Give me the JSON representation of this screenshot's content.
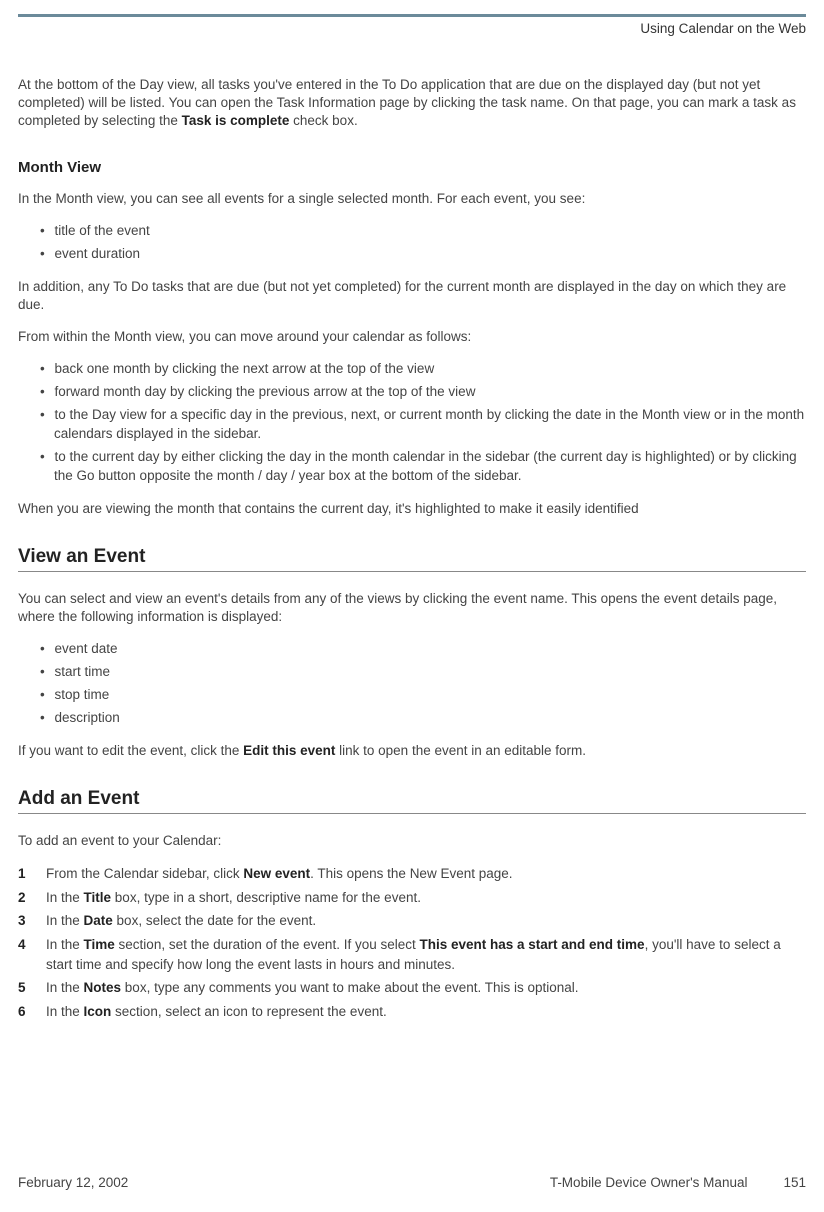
{
  "header": {
    "running_title": "Using Calendar on the Web"
  },
  "intro": {
    "pre": "At the bottom of the Day view, all tasks you've entered in the To Do application that are due on the displayed day (but not yet completed) will be listed. You can open the Task Information page by clicking the task name. On that page, you can mark a task as completed by selecting the ",
    "bold": "Task is complete",
    "post": " check box."
  },
  "month_view": {
    "heading": "Month View",
    "p1": "In the Month view, you can see all events for a single selected month. For each event, you see:",
    "list1": [
      "title of the event",
      "event duration"
    ],
    "p2": "In addition, any To Do tasks that are due (but not yet completed) for the current month are displayed in the day on which they are due.",
    "p3": "From within the Month view, you can move around your calendar as follows:",
    "list2": [
      "back one month by clicking the next arrow at the top of the view",
      "forward month day by clicking the previous arrow at the top of the view",
      "to the Day view for a specific day in the previous, next, or current month by clicking the date in the Month view or in the month calendars displayed in the sidebar.",
      "to the current day by either clicking the day in the month calendar in the sidebar (the current day is highlighted) or by clicking the Go button opposite the month / day / year box at the bottom of the sidebar."
    ],
    "p4": "When you are viewing the month that contains the current day, it's highlighted to make it easily identified"
  },
  "view_event": {
    "heading": "View an Event",
    "p1": "You can select and view an event's details from any of the views by clicking the event name. This opens the event details page, where the following information is displayed:",
    "list": [
      "event date",
      "start time",
      "stop time",
      "description"
    ],
    "p2_pre": "If you want to edit the event, click the ",
    "p2_bold": "Edit this event",
    "p2_post": " link to open the event in an editable form."
  },
  "add_event": {
    "heading": "Add an Event",
    "p1": "To add an event to your Calendar:",
    "steps": [
      {
        "pre": "From the Calendar sidebar, click ",
        "bold": "New event",
        "post": ". This opens the New Event page."
      },
      {
        "pre": "In the ",
        "bold": "Title",
        "post": " box, type in a short, descriptive name for the event."
      },
      {
        "pre": "In the ",
        "bold": "Date",
        "post": " box, select the date for the event."
      },
      {
        "pre": "In the ",
        "bold": "Time",
        "mid": " section, set the duration of the event. If you select ",
        "bold2": "This event has a start and end time",
        "post": ", you'll have to select a start time and specify how long the event lasts in hours and minutes."
      },
      {
        "pre": "In the ",
        "bold": "Notes",
        "post": " box, type any comments you want to make about the event. This is optional."
      },
      {
        "pre": "In the ",
        "bold": "Icon",
        "post": " section, select an icon to represent the event."
      }
    ]
  },
  "footer": {
    "date": "February 12, 2002",
    "manual": "T-Mobile Device Owner's Manual",
    "page": "151"
  }
}
